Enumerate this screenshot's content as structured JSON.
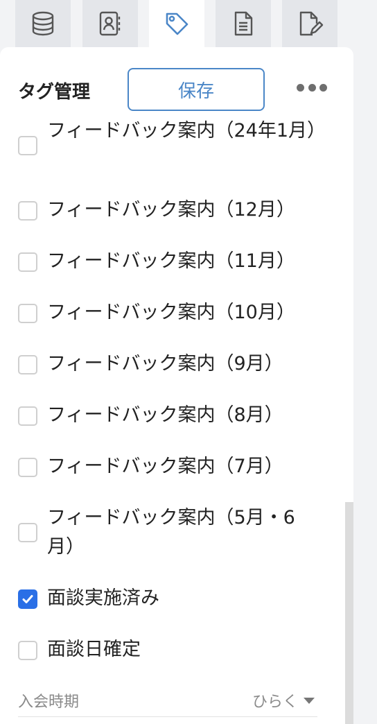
{
  "tabs": [
    {
      "icon": "database-icon",
      "active": false
    },
    {
      "icon": "contacts-icon",
      "active": false
    },
    {
      "icon": "tag-icon",
      "active": true
    },
    {
      "icon": "document-icon",
      "active": false
    },
    {
      "icon": "edit-document-icon",
      "active": false
    }
  ],
  "header": {
    "title": "タグ管理",
    "save_label": "保存"
  },
  "tags": [
    {
      "label": "フィードバック案内（24年1月）",
      "checked": false
    },
    {
      "label": "フィードバック案内（12月）",
      "checked": false
    },
    {
      "label": "フィードバック案内（11月）",
      "checked": false
    },
    {
      "label": "フィードバック案内（10月）",
      "checked": false
    },
    {
      "label": "フィードバック案内（9月）",
      "checked": false
    },
    {
      "label": "フィードバック案内（8月）",
      "checked": false
    },
    {
      "label": "フィードバック案内（7月）",
      "checked": false
    },
    {
      "label": "フィードバック案内（5月・6月）",
      "checked": false
    },
    {
      "label": "面談実施済み",
      "checked": true
    },
    {
      "label": "面談日確定",
      "checked": false
    }
  ],
  "section": {
    "label": "入会時期",
    "toggle_label": "ひらく"
  },
  "colors": {
    "accent": "#2a6fe6",
    "button_border": "#4a86c7"
  }
}
